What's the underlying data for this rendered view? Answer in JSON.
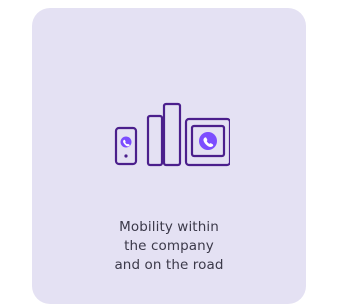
{
  "card": {
    "icon_name": "devices-call-icon",
    "accent_color": "#4b1f8c",
    "highlight_color": "#7c4dff",
    "caption_lines": [
      "Mobility within",
      "the company",
      "and on the road"
    ]
  }
}
